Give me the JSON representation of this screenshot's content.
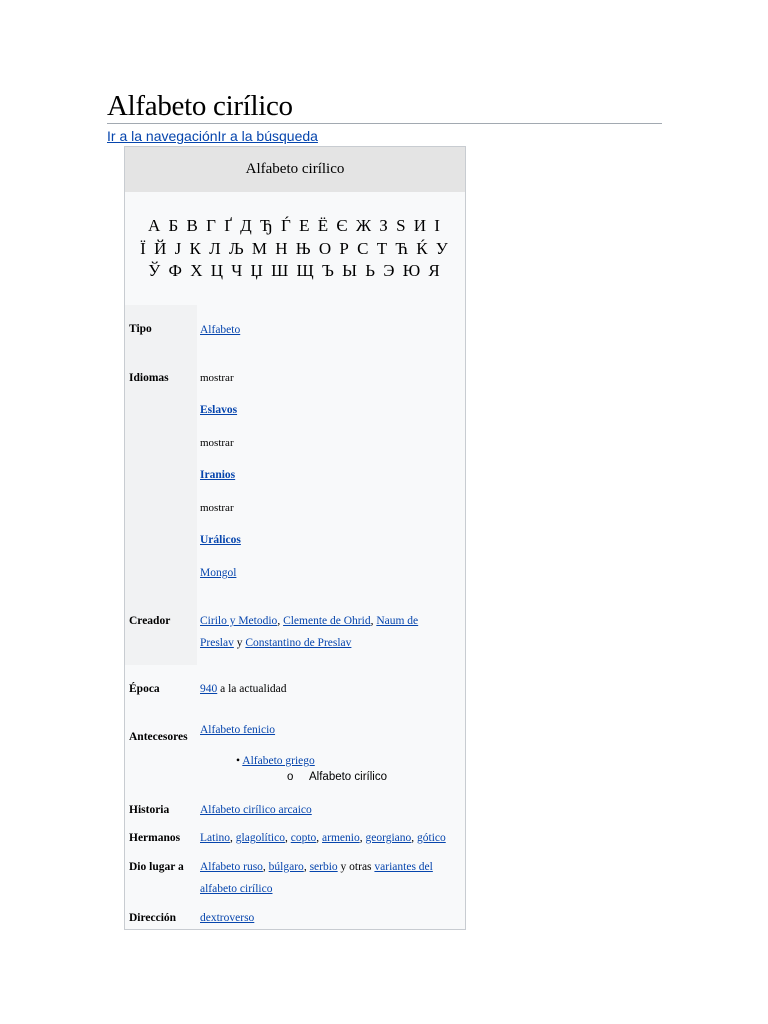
{
  "page": {
    "title": "Alfabeto cirílico",
    "jump_nav": "Ir a la navegación",
    "jump_search": "Ir a la búsqueda"
  },
  "infobox": {
    "header": "Alfabeto cirílico",
    "letters": [
      "А Б В Г Ґ Д Ђ Ѓ Е Ё Є Ж З Ѕ И І",
      "Ї Й Ј К Л Љ М Н Њ О Р С Т Ћ Ќ У",
      "Ў Ф Х Ц Ч Џ Ш Щ Ъ Ы Ь Э Ю Я"
    ],
    "tipo": {
      "label": "Tipo",
      "value": "Alfabeto"
    },
    "idiomas": {
      "label": "Idiomas",
      "toggle_1": "mostrar",
      "group_1": "Eslavos",
      "toggle_2": "mostrar",
      "group_2": "Iranios",
      "toggle_3": "mostrar",
      "group_3": "Urálicos",
      "extra": "Mongol"
    },
    "creador": {
      "label": "Creador",
      "link_1": "Cirilo y Metodio",
      "sep_1": ", ",
      "link_2": "Clemente de Ohrid",
      "sep_2": ", ",
      "link_3a": "Naum de",
      "link_3b": "Preslav",
      "conj": " y ",
      "link_4": "Constantino de Preslav"
    },
    "epoca": {
      "label": "Época",
      "link": "940",
      "rest": " a la actualidad"
    },
    "antecesores": {
      "label": "Antecesores",
      "link": "Alfabeto fenicio",
      "bullet": "•",
      "sub_link": "Alfabeto griego",
      "sub_marker": "o",
      "sub_sub": "Alfabeto cirílico"
    },
    "historia": {
      "label": "Historia",
      "link": "Alfabeto cirílico arcaico"
    },
    "hermanos": {
      "label": "Hermanos",
      "l1": "Latino",
      "l2": "glagolítico",
      "l3": "copto",
      "l4": "armenio",
      "l5": "georgiano",
      "l6": "gótico",
      "sep": ", "
    },
    "dio_lugar": {
      "label": "Dio lugar a",
      "l1": "Alfabeto ruso",
      "sep1": ", ",
      "l2": "búlgaro",
      "sep2": ", ",
      "l3": "serbio",
      "mid": " y otras ",
      "l4a": "variantes del",
      "l4b": "alfabeto cirílico"
    },
    "direccion": {
      "label": "Dirección",
      "link": "dextroverso"
    }
  }
}
